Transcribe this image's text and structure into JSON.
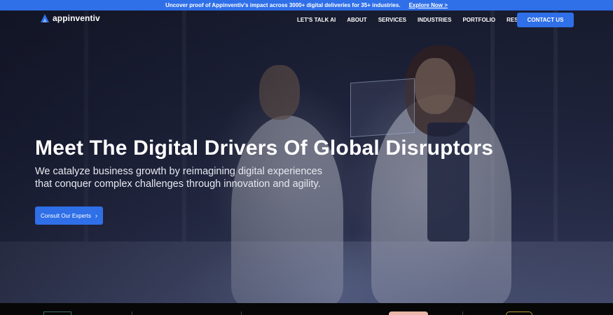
{
  "announcement": {
    "text": "Uncover proof of Appinventiv's impact across 3000+ digital deliveries for 35+ industries.",
    "link": "Explore Now >"
  },
  "brand": {
    "name": "appinventiv",
    "logo_icon": "appinventiv-logo-icon"
  },
  "nav": {
    "items": [
      "LET'S TALK AI",
      "ABOUT",
      "SERVICES",
      "INDUSTRIES",
      "PORTFOLIO",
      "RESOURCES"
    ],
    "contact_label": "CONTACT US"
  },
  "hero": {
    "headline": "Meet The Digital Drivers Of Global Disruptors",
    "subheadline": "We catalyze business growth by reimagining digital experiences that conquer complex challenges through innovation and agility.",
    "cta_label": "Consult Our Experts",
    "cta_icon": "chevron-right-icon"
  },
  "colors": {
    "accent": "#2f6fe8",
    "announcement_bg": "#2f6fe8",
    "footer_strip": "#070707"
  }
}
